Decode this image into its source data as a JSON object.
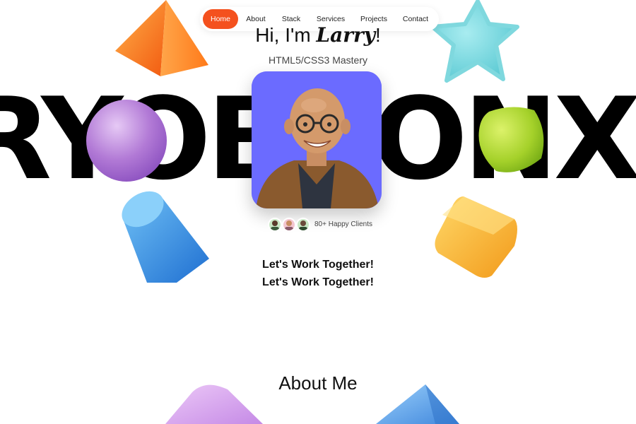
{
  "nav": {
    "items": [
      {
        "label": "Home",
        "active": true
      },
      {
        "label": "About",
        "active": false
      },
      {
        "label": "Stack",
        "active": false
      },
      {
        "label": "Services",
        "active": false
      },
      {
        "label": "Projects",
        "active": false
      },
      {
        "label": "Contact",
        "active": false
      }
    ]
  },
  "hero": {
    "greeting": "Hi, I'm ",
    "name": "Larry",
    "punct": "!",
    "subtitle": "HTML5/CSS3 Mastery"
  },
  "marquee": {
    "text": "RYOBRONX L"
  },
  "clients": {
    "label": "80+ Happy Clients"
  },
  "cta": {
    "label": "Let's Work Together!"
  },
  "about": {
    "heading": "About Me"
  },
  "colors": {
    "accent": "#f4511e",
    "portrait_bg": "#6b6bff"
  }
}
